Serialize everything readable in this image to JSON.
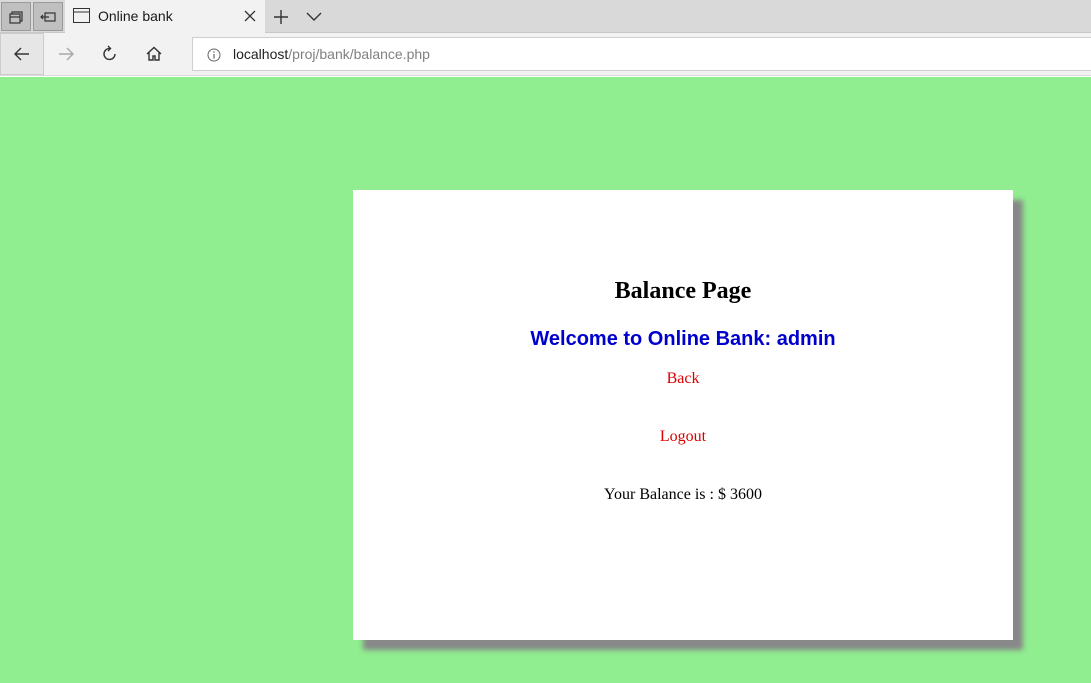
{
  "browser": {
    "tab": {
      "title": "Online bank"
    },
    "address": {
      "host": "localhost",
      "path": "/proj/bank/balance.php"
    }
  },
  "page": {
    "heading": "Balance Page",
    "welcome": "Welcome to Online Bank: admin",
    "links": {
      "back": "Back",
      "logout": "Logout"
    },
    "balance_text": "Your Balance is : $ 3600"
  },
  "colors": {
    "page_background": "#90ee90",
    "welcome_text": "#0000cd",
    "link_text": "#dd0000"
  }
}
